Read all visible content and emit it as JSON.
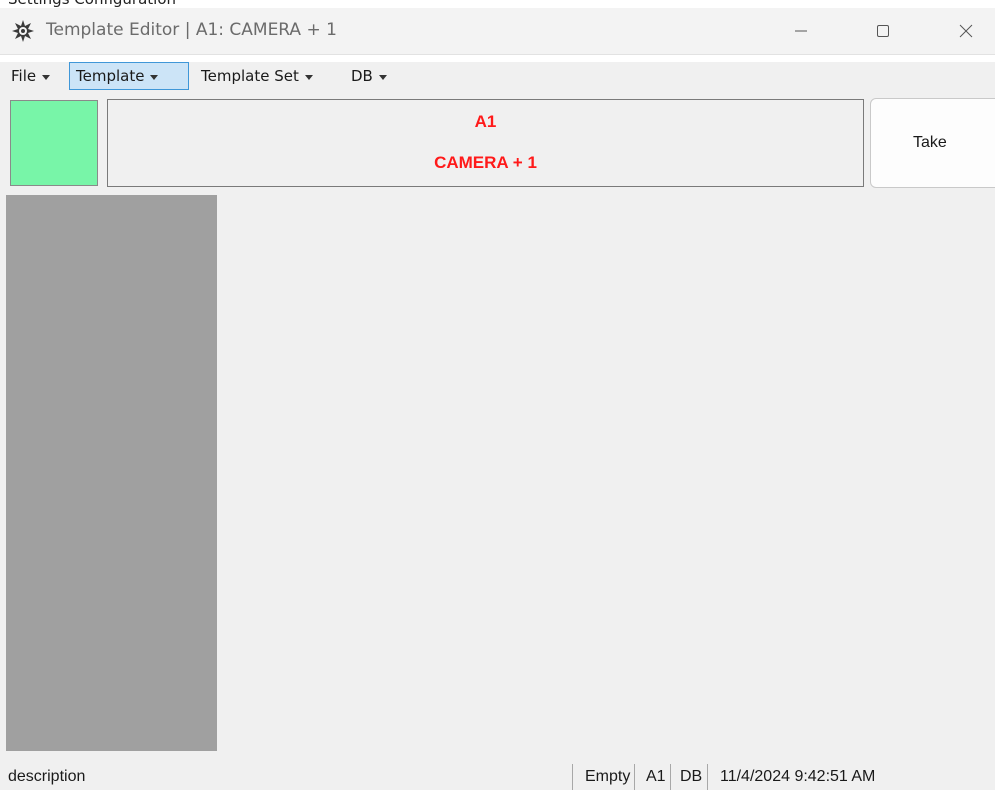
{
  "window": {
    "title": "Template Editor | A1: CAMERA + 1",
    "top_cut_text": "Settings Configuration"
  },
  "menu": {
    "items": [
      {
        "label": "File"
      },
      {
        "label": "Template"
      },
      {
        "label": "Template Set"
      },
      {
        "label": "DB"
      }
    ]
  },
  "header": {
    "line1": "A1",
    "line2": "CAMERA + 1",
    "text_color": "#ff1a1a",
    "swatch_color": "#78f5a8"
  },
  "take_button": {
    "label": "Take"
  },
  "status": {
    "description": "description",
    "state": "Empty",
    "slot": "A1",
    "source": "DB",
    "timestamp": "11/4/2024 9:42:51 AM"
  },
  "icons": {
    "app": "gear-app-icon",
    "minimize": "minimize-icon",
    "maximize": "maximize-icon",
    "close": "close-icon"
  }
}
